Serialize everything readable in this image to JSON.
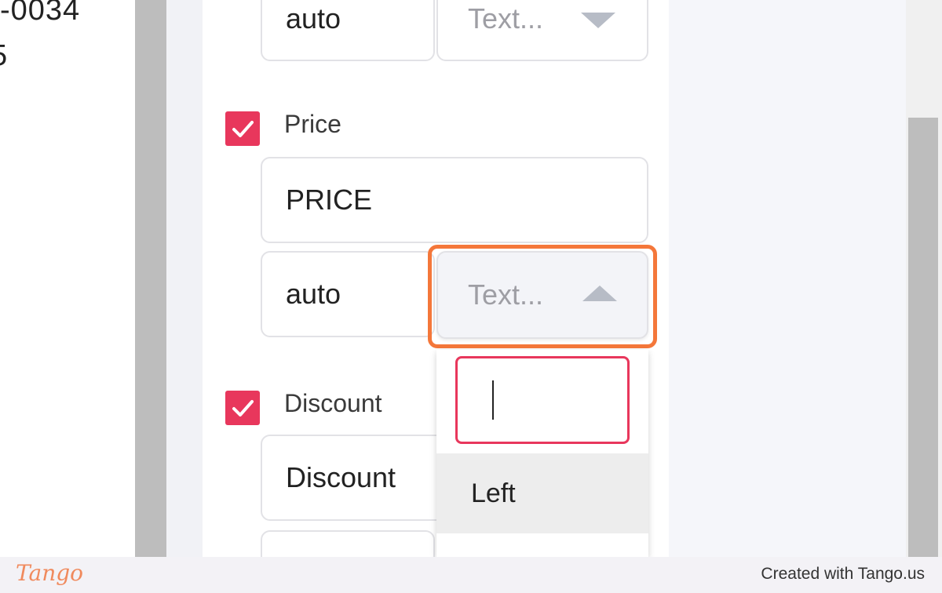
{
  "left_doc": {
    "fragment_top": "-0034",
    "fragment_second": "5"
  },
  "columns": [
    {
      "width_value": "auto",
      "align_placeholder": "Text..."
    },
    {
      "checked": true,
      "label": "Price",
      "name_value": "PRICE",
      "width_value": "auto",
      "align_placeholder": "Text...",
      "dropdown_open": true
    },
    {
      "checked": true,
      "label": "Discount",
      "name_value": "Discount"
    }
  ],
  "dropdown": {
    "search_value": "",
    "options": [
      "Left"
    ]
  },
  "colors": {
    "checkbox": "#e8375c",
    "highlight": "#f4773a",
    "search_border": "#e8375c"
  },
  "footer": {
    "logo": "Tango",
    "credit": "Created with Tango.us"
  }
}
